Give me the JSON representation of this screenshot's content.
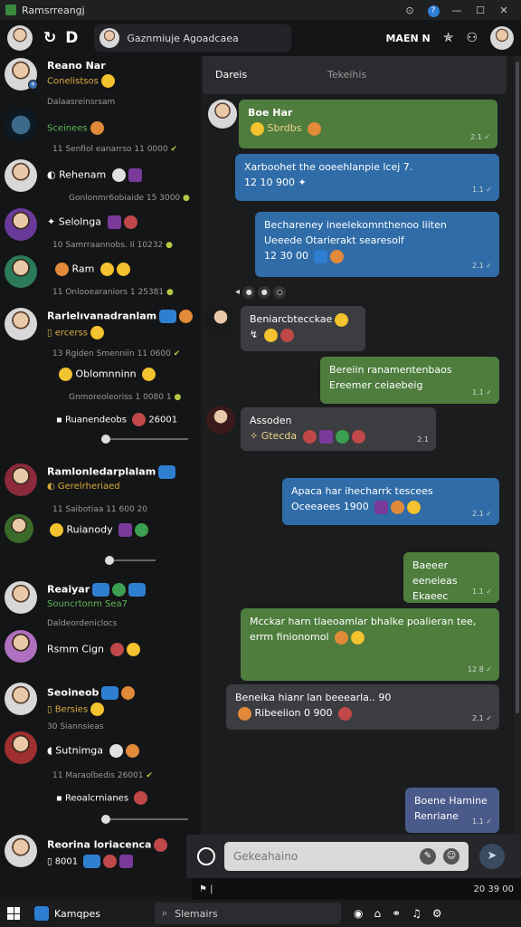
{
  "window": {
    "title": "Ramsrreangj"
  },
  "header": {
    "chat_title": "Gaznmiuje Agoadcaea",
    "user_name": "MAEN N"
  },
  "sidebar": {
    "conversations": [
      {
        "name": "Reano Nar",
        "sub": "Conelistsos",
        "meta": "Dalaasreinsrsam"
      },
      {
        "name": "Sceinees",
        "meta": "Senfiol eanarrso 11 0000"
      },
      {
        "name": "Rehenam",
        "meta": "Gonlonmr6obiaide 15 3000"
      },
      {
        "name": "Selolnga",
        "meta": "Samrraannobs. Ii 10232"
      },
      {
        "name": "Ram",
        "meta": "Onlooearaniors 1 25381"
      },
      {
        "name": "Rarlelıvanadranlam",
        "sub": "ercerss",
        "meta": "Rgiden Smenniin 11 0600"
      },
      {
        "name": "Oblomnninn",
        "meta": "Gnmoreoleoriss 1 0080 1"
      },
      {
        "name": "Ruanendeobs",
        "meta": "26001"
      },
      {
        "name": "Ramlonledarplalam",
        "sub": "Gerelrheriaed",
        "meta": "Saibotiaa 11 600 20"
      },
      {
        "name": "Ruianody"
      },
      {
        "name": "Reaiyar",
        "sub": "Souncrtonm Sea7",
        "meta": "Daldeordeniclocs"
      },
      {
        "name": "Rsmm Cign"
      },
      {
        "name": "Seoineob",
        "sub": "Bersies",
        "meta": "Siannsieas"
      },
      {
        "name": "Sutnimga"
      },
      {
        "name": "Reoalcrnianes",
        "meta": "Maraolbedis 26001"
      },
      {
        "name": "Reorina loriacenca",
        "sub": "8001"
      }
    ]
  },
  "chat": {
    "tabs": [
      "Dareis",
      "Tekeihis"
    ],
    "messages": [
      {
        "sender": "Boe Har",
        "text": "Sbrdbs",
        "time": "2.1 ✓"
      },
      {
        "text": "Xarboohet the ooeehlanpie lcej 7.",
        "text2": "12 10 900",
        "time": "1.1 ✓"
      },
      {
        "text": "Bechareney ineelekomnthenoo liiten",
        "text2": "Ueeede Otarierakt searesolf",
        "text3": "12 30 00",
        "time": "2.1 ✓"
      },
      {
        "text": "Beniarcbtecckae",
        "text2": "",
        "time": ""
      },
      {
        "text": "Bereiin ranamentenbaos",
        "text2": "Ereemer ceiaebeig",
        "time": "1.1 ✓"
      },
      {
        "text": "Assoden",
        "text2": "Gtecda",
        "time": "2.1"
      },
      {
        "text": "Apaca har ihecharrk tescees",
        "text2": "Oceeaees 1900",
        "time": "2.1 ✓"
      },
      {
        "text": "Baeeer eeneieas",
        "text2": "Ekaeec",
        "time": "1.1 ✓"
      },
      {
        "text": "Mcckar harn tlaeoamlar bhalke poalieran tee,",
        "text2": "errm finionomol",
        "time": "12 8 ✓"
      },
      {
        "text": "Beneika hianr lan beeearla..  90",
        "text2": "Ribeeiion   0 900",
        "time": "2.1 ✓"
      },
      {
        "text": "Boene Hamine",
        "text2": "Renriane",
        "time": "1.1 ✓"
      }
    ]
  },
  "composer": {
    "placeholder": "Gekeahaino",
    "status_time": "20 39 00"
  },
  "taskbar": {
    "app_label": "Kamqpes",
    "search_placeholder": "Slemairs"
  }
}
